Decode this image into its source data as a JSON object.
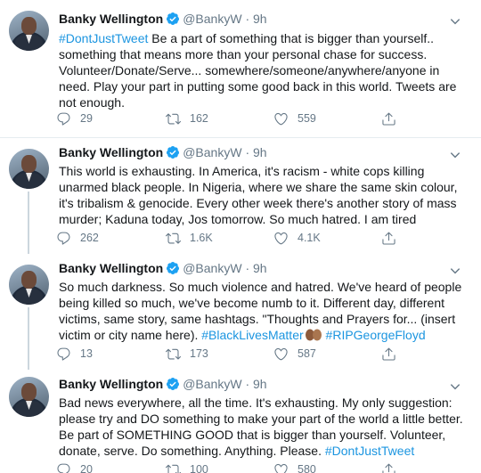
{
  "tweets": [
    {
      "name": "Banky Wellington",
      "handle": "@BankyW",
      "sep": "·",
      "time": "9h",
      "body": [
        {
          "text": "#DontJustTweet",
          "tag": true
        },
        {
          "text": " Be a part of something that is bigger than yourself.. something that means more than your personal chase for success. Volunteer/Donate/Serve... somewhere/someone/anywhere/anyone in need. Play your part in putting some good back in this world. Tweets are not enough.",
          "tag": false
        }
      ],
      "replies": "29",
      "retweets": "162",
      "likes": "559"
    },
    {
      "name": "Banky Wellington",
      "handle": "@BankyW",
      "sep": "·",
      "time": "9h",
      "body": [
        {
          "text": "This world is exhausting. In America, it's racism - white cops killing unarmed black people. In Nigeria, where we share the same skin colour, it's tribalism & genocide. Every other week there's another story of mass murder; Kaduna today, Jos tomorrow. So much hatred. I am tired",
          "tag": false
        }
      ],
      "replies": "262",
      "retweets": "1.6K",
      "likes": "4.1K"
    },
    {
      "name": "Banky Wellington",
      "handle": "@BankyW",
      "sep": "·",
      "time": "9h",
      "body": [
        {
          "text": "So much darkness. So much violence and hatred. We've heard of people being killed so much, we've become numb to it. Different day, different victims, same story, same hashtags. \"Thoughts and Prayers for... (insert victim or city name here). ",
          "tag": false
        },
        {
          "text": "#BlackLivesMatter",
          "tag": true
        },
        {
          "emoji": "folded-hands-emoji"
        },
        {
          "text": " #RIPGeorgeFloyd",
          "tag": true
        }
      ],
      "replies": "13",
      "retweets": "173",
      "likes": "587"
    },
    {
      "name": "Banky Wellington",
      "handle": "@BankyW",
      "sep": "·",
      "time": "9h",
      "body": [
        {
          "text": "Bad news everywhere, all the time. It's exhausting. My only suggestion: please try and DO something to make your part of the world a little better. Be part of SOMETHING GOOD that is bigger than yourself. Volunteer, donate, serve. Do something. Anything. Please. ",
          "tag": false
        },
        {
          "text": "#DontJustTweet",
          "tag": true
        }
      ],
      "replies": "20",
      "retweets": "100",
      "likes": "580"
    }
  ],
  "icons": {
    "reply": "reply-icon",
    "retweet": "retweet-icon",
    "like": "heart-icon",
    "share": "share-icon",
    "verified": "verified-badge-icon",
    "more": "chevron-down-icon"
  },
  "colors": {
    "link": "#1b95e0",
    "muted": "#657786",
    "verified": "#1da1f2",
    "thread_line": "#ccd6dd"
  }
}
